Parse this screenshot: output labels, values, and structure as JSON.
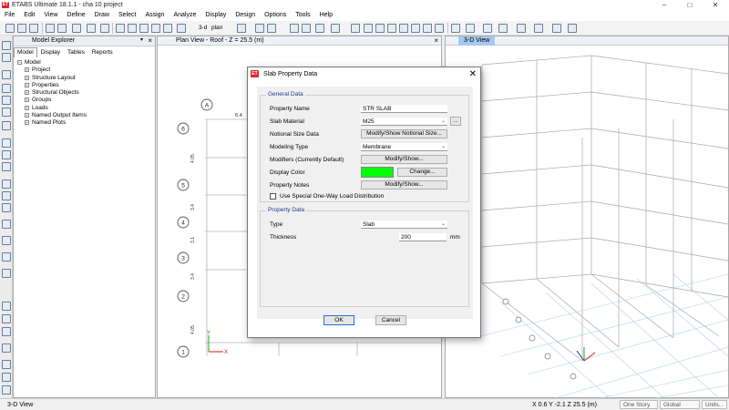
{
  "app": {
    "title": "ETABS Ultimate 18.1.1 - cha 10 project",
    "logo_text": "ET",
    "window_controls": [
      "–",
      "□",
      "✕"
    ]
  },
  "menu": [
    "File",
    "Edit",
    "View",
    "Define",
    "Draw",
    "Select",
    "Assign",
    "Analyze",
    "Display",
    "Design",
    "Options",
    "Tools",
    "Help"
  ],
  "toolbar": {
    "view_3d_label": "3-d",
    "plan_label": "plan"
  },
  "model_explorer": {
    "title": "Model Explorer",
    "tabs": [
      "Model",
      "Display",
      "Tables",
      "Reports"
    ],
    "active_tab": "Model",
    "root": "Model",
    "items": [
      "Project",
      "Structure Layout",
      "Properties",
      "Structural Objects",
      "Groups",
      "Loads",
      "Named Output Items",
      "Named Plots"
    ]
  },
  "plan_view": {
    "title": "Plan View - Roof - Z = 25.5 (m)",
    "grid_bubble_top": "A",
    "top_dimension": "6.4",
    "row_bubbles": [
      "6",
      "5",
      "4",
      "3",
      "2",
      "1"
    ],
    "dimensions": [
      "4.05",
      "3.4",
      "3.1",
      "3.4",
      "4.05"
    ],
    "axis_x": "X",
    "axis_y": "Y"
  },
  "view_3d": {
    "title": "3-D View"
  },
  "dialog": {
    "title": "Slab Property Data",
    "general_group": "General Data",
    "property_name_label": "Property Name",
    "property_name_value": "STR SLAB",
    "slab_material_label": "Slab Material",
    "slab_material_value": "M25",
    "material_ellipsis": "...",
    "notional_label": "Notional Size Data",
    "notional_button": "Modify/Show Notional Size...",
    "modeling_type_label": "Modeling Type",
    "modeling_type_value": "Membrane",
    "modifiers_label": "Modifiers (Currently Default)",
    "modifiers_button": "Modify/Show...",
    "display_color_label": "Display Color",
    "display_color_value": "#00ff00",
    "change_button": "Change...",
    "notes_label": "Property Notes",
    "notes_button": "Modify/Show...",
    "one_way_label": "Use Special One-Way Load Distribution",
    "one_way_checked": false,
    "property_group": "Property Data",
    "type_label": "Type",
    "type_value": "Slab",
    "thickness_label": "Thickness",
    "thickness_value": "200",
    "thickness_unit": "mm",
    "ok_button": "OK",
    "cancel_button": "Cancel"
  },
  "status": {
    "left": "3-D View",
    "coords": "X 0.6  Y -2.1  Z 25.5 (m)",
    "story": "One Story",
    "coord_system": "Global",
    "units": "Units..."
  }
}
